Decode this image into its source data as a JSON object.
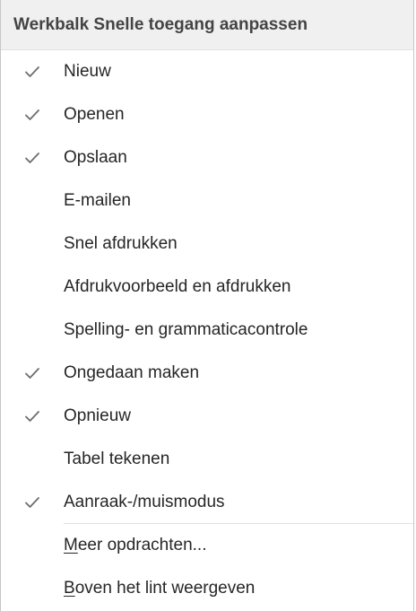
{
  "menu": {
    "header": "Werkbalk Snelle toegang aanpassen",
    "check_icon": "checkmark-icon",
    "check_color": "#6d6d6d",
    "items": [
      {
        "label": "Nieuw",
        "checked": true
      },
      {
        "label": "Openen",
        "checked": true
      },
      {
        "label": "Opslaan",
        "checked": true
      },
      {
        "label": "E-mailen",
        "checked": false
      },
      {
        "label": "Snel afdrukken",
        "checked": false
      },
      {
        "label": "Afdrukvoorbeeld en afdrukken",
        "checked": false
      },
      {
        "label": "Spelling- en grammaticacontrole",
        "checked": false
      },
      {
        "label": "Ongedaan maken",
        "checked": true
      },
      {
        "label": "Opnieuw",
        "checked": true
      },
      {
        "label": "Tabel tekenen",
        "checked": false
      },
      {
        "label": "Aanraak-/muismodus",
        "checked": true
      }
    ],
    "more_commands": {
      "accel": "M",
      "rest": "eer opdrachten..."
    },
    "show_above_ribbon": {
      "accel": "B",
      "rest": "oven het lint weergeven"
    }
  }
}
